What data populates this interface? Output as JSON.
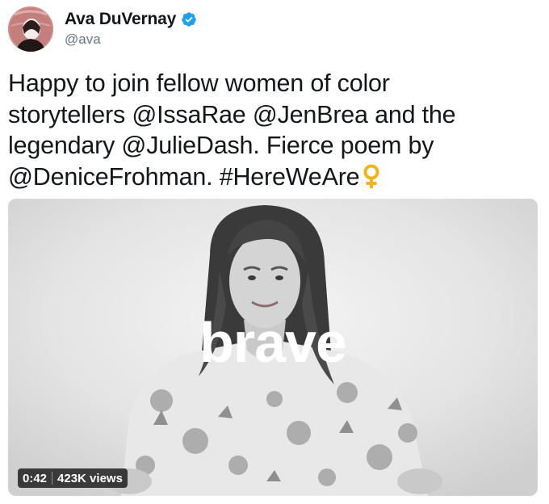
{
  "author": {
    "name": "Ava DuVernay",
    "handle": "@ava",
    "verified": true,
    "avatar_icon": "profile-photo-avatar"
  },
  "tweet": {
    "lines": [
      {
        "text": "Happy to join fellow women of color"
      },
      {
        "text": "storytellers @IssaRae @JenBrea and the"
      },
      {
        "text": "legendary @JulieDash. Fierce poem by"
      },
      {
        "text": "@DeniceFrohman. #HereWeAre"
      }
    ],
    "emoji": "female-sign-emoji",
    "emoji_color": "#f2b418"
  },
  "media": {
    "type": "video",
    "overlay_text": "brave",
    "duration": "0:42",
    "views": "423K views"
  },
  "colors": {
    "verified": "#1da1f2",
    "text": "#14171a",
    "handle": "#657786"
  }
}
